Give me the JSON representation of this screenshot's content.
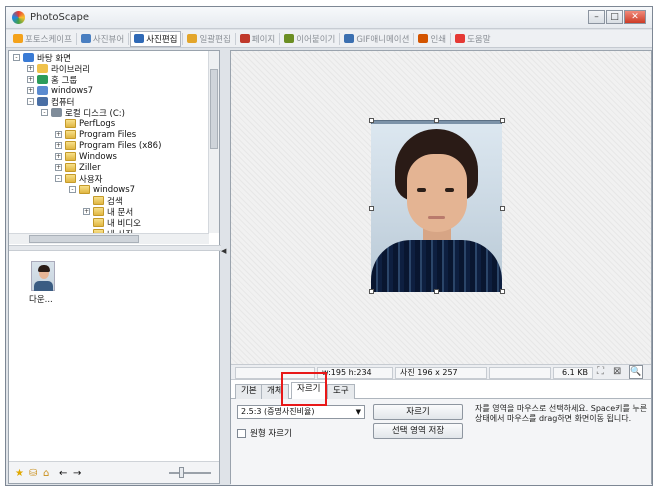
{
  "window": {
    "title": "PhotoScape"
  },
  "app_tabs": [
    {
      "label": "포토스케이프",
      "icon": "photoscape-icon",
      "color": "#f4a21b",
      "active": false
    },
    {
      "label": "사진뷰어",
      "icon": "viewer-icon",
      "color": "#4a7fc1",
      "active": false
    },
    {
      "label": "사진편집",
      "icon": "editor-icon",
      "color": "#2f69b6",
      "active": true
    },
    {
      "label": "일괄편집",
      "icon": "batch-icon",
      "color": "#e3a52a",
      "active": false
    },
    {
      "label": "페이지",
      "icon": "page-icon",
      "color": "#c0392b",
      "active": false
    },
    {
      "label": "이어붙이기",
      "icon": "combine-icon",
      "color": "#6b8e23",
      "active": false
    },
    {
      "label": "GIF애니메이션",
      "icon": "gif-icon",
      "color": "#3b6fb0",
      "active": false
    },
    {
      "label": "인쇄",
      "icon": "print-icon",
      "color": "#d35400",
      "active": false
    },
    {
      "label": "도움말",
      "icon": "help-icon",
      "color": "#e53935",
      "active": false
    }
  ],
  "tree": [
    {
      "label": "바탕 화면",
      "indent": 0,
      "expander": "-",
      "icon": "desktop-icon"
    },
    {
      "label": "라이브러리",
      "indent": 1,
      "expander": "+",
      "icon": "library-icon"
    },
    {
      "label": "홈 그룹",
      "indent": 1,
      "expander": "+",
      "icon": "homegroup-icon"
    },
    {
      "label": "windows7",
      "indent": 1,
      "expander": "+",
      "icon": "user-folder-icon"
    },
    {
      "label": "컴퓨터",
      "indent": 1,
      "expander": "-",
      "icon": "computer-icon"
    },
    {
      "label": "로컬 디스크 (C:)",
      "indent": 2,
      "expander": "-",
      "icon": "drive-icon"
    },
    {
      "label": "PerfLogs",
      "indent": 3,
      "expander": "",
      "icon": "folder-icon"
    },
    {
      "label": "Program Files",
      "indent": 3,
      "expander": "+",
      "icon": "folder-icon"
    },
    {
      "label": "Program Files (x86)",
      "indent": 3,
      "expander": "+",
      "icon": "folder-icon"
    },
    {
      "label": "Windows",
      "indent": 3,
      "expander": "+",
      "icon": "folder-icon"
    },
    {
      "label": "Ziller",
      "indent": 3,
      "expander": "+",
      "icon": "folder-icon"
    },
    {
      "label": "사용자",
      "indent": 3,
      "expander": "-",
      "icon": "folder-icon"
    },
    {
      "label": "windows7",
      "indent": 4,
      "expander": "-",
      "icon": "folder-icon"
    },
    {
      "label": "검색",
      "indent": 5,
      "expander": "",
      "icon": "search-folder-icon"
    },
    {
      "label": "내 문서",
      "indent": 5,
      "expander": "+",
      "icon": "documents-folder-icon"
    },
    {
      "label": "내 비디오",
      "indent": 5,
      "expander": "",
      "icon": "video-folder-icon"
    },
    {
      "label": "내 사진",
      "indent": 5,
      "expander": "",
      "icon": "pictures-folder-icon"
    }
  ],
  "thumbnail": {
    "label": "다운..."
  },
  "status": {
    "coords": "w:195 h:234",
    "photo_size": "사진 196 x 257",
    "file_size": "6.1 KB"
  },
  "panel_tabs": [
    {
      "label": "기본",
      "active": false
    },
    {
      "label": "개체",
      "active": false
    },
    {
      "label": "자르기",
      "active": true
    },
    {
      "label": "도구",
      "active": false
    }
  ],
  "crop": {
    "ratio_value": "2.5:3 (증명사진비율)",
    "round_label": "원형 자르기",
    "crop_button": "자르기",
    "save_selection_button": "선택 영역 저장",
    "help_text": "자를 영역을 마우스로 선택하세요. Space키를 누른 상태에서 마우스를 drag하면 화면이동 됩니다."
  },
  "highlight_color": "#e81818"
}
